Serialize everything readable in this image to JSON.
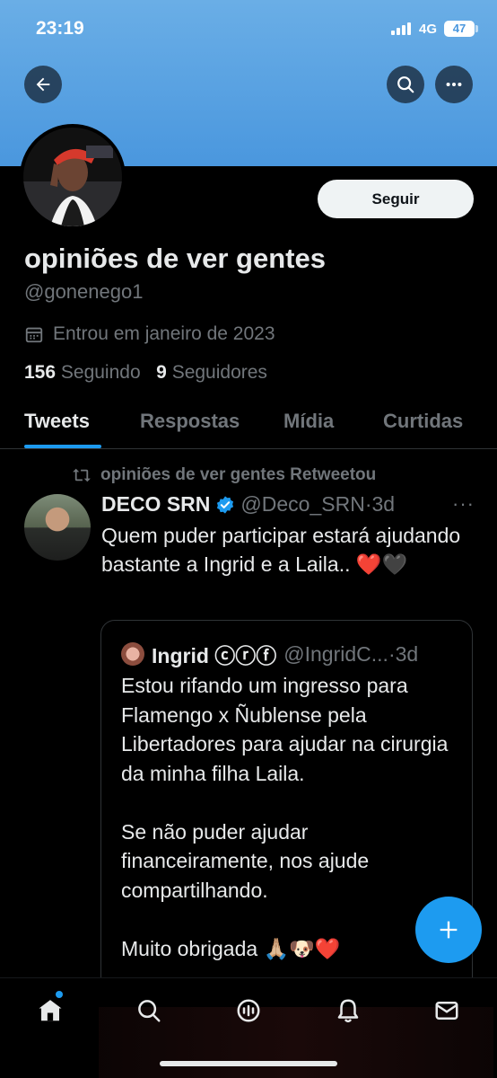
{
  "status_bar": {
    "time": "23:19",
    "network": "4G",
    "battery": "47"
  },
  "header": {
    "back_icon": "arrow-left-icon",
    "search_icon": "search-icon",
    "more_icon": "more-icon"
  },
  "profile": {
    "follow_label": "Seguir",
    "name": "opiniões de ver gentes",
    "handle": "@gonenego1",
    "joined": "Entrou em janeiro de 2023",
    "following_count": "156",
    "following_label": "Seguindo",
    "followers_count": "9",
    "followers_label": "Seguidores"
  },
  "tabs": [
    {
      "label": "Tweets",
      "active": true
    },
    {
      "label": "Respostas",
      "active": false
    },
    {
      "label": "Mídia",
      "active": false
    },
    {
      "label": "Curtidas",
      "active": false
    }
  ],
  "tweet": {
    "retweet_line": "opiniões de ver gentes Retweetou",
    "author_name": "DECO SRN",
    "author_handle": "@Deco_SRN",
    "time": "·3d",
    "more": "···",
    "text": "Quem puder participar estará ajudando bastante a Ingrid e a Laila.. ❤️🖤",
    "quote": {
      "author_name": "Ingrid ⓒⓡⓕ",
      "author_handle": "@IngridC...",
      "time": "·3d",
      "text": "Estou rifando um ingresso para Flamengo x Ñublense pela Libertadores para ajudar na cirurgia da minha filha Laila.\n\nSe não puder ajudar financeiramente, nos ajude compartilhando.\n\nMuito obrigada 🙏🏼🐶❤️"
    }
  },
  "colors": {
    "accent": "#1d9bf0",
    "banner": "#4a97de",
    "muted": "#71767b"
  }
}
